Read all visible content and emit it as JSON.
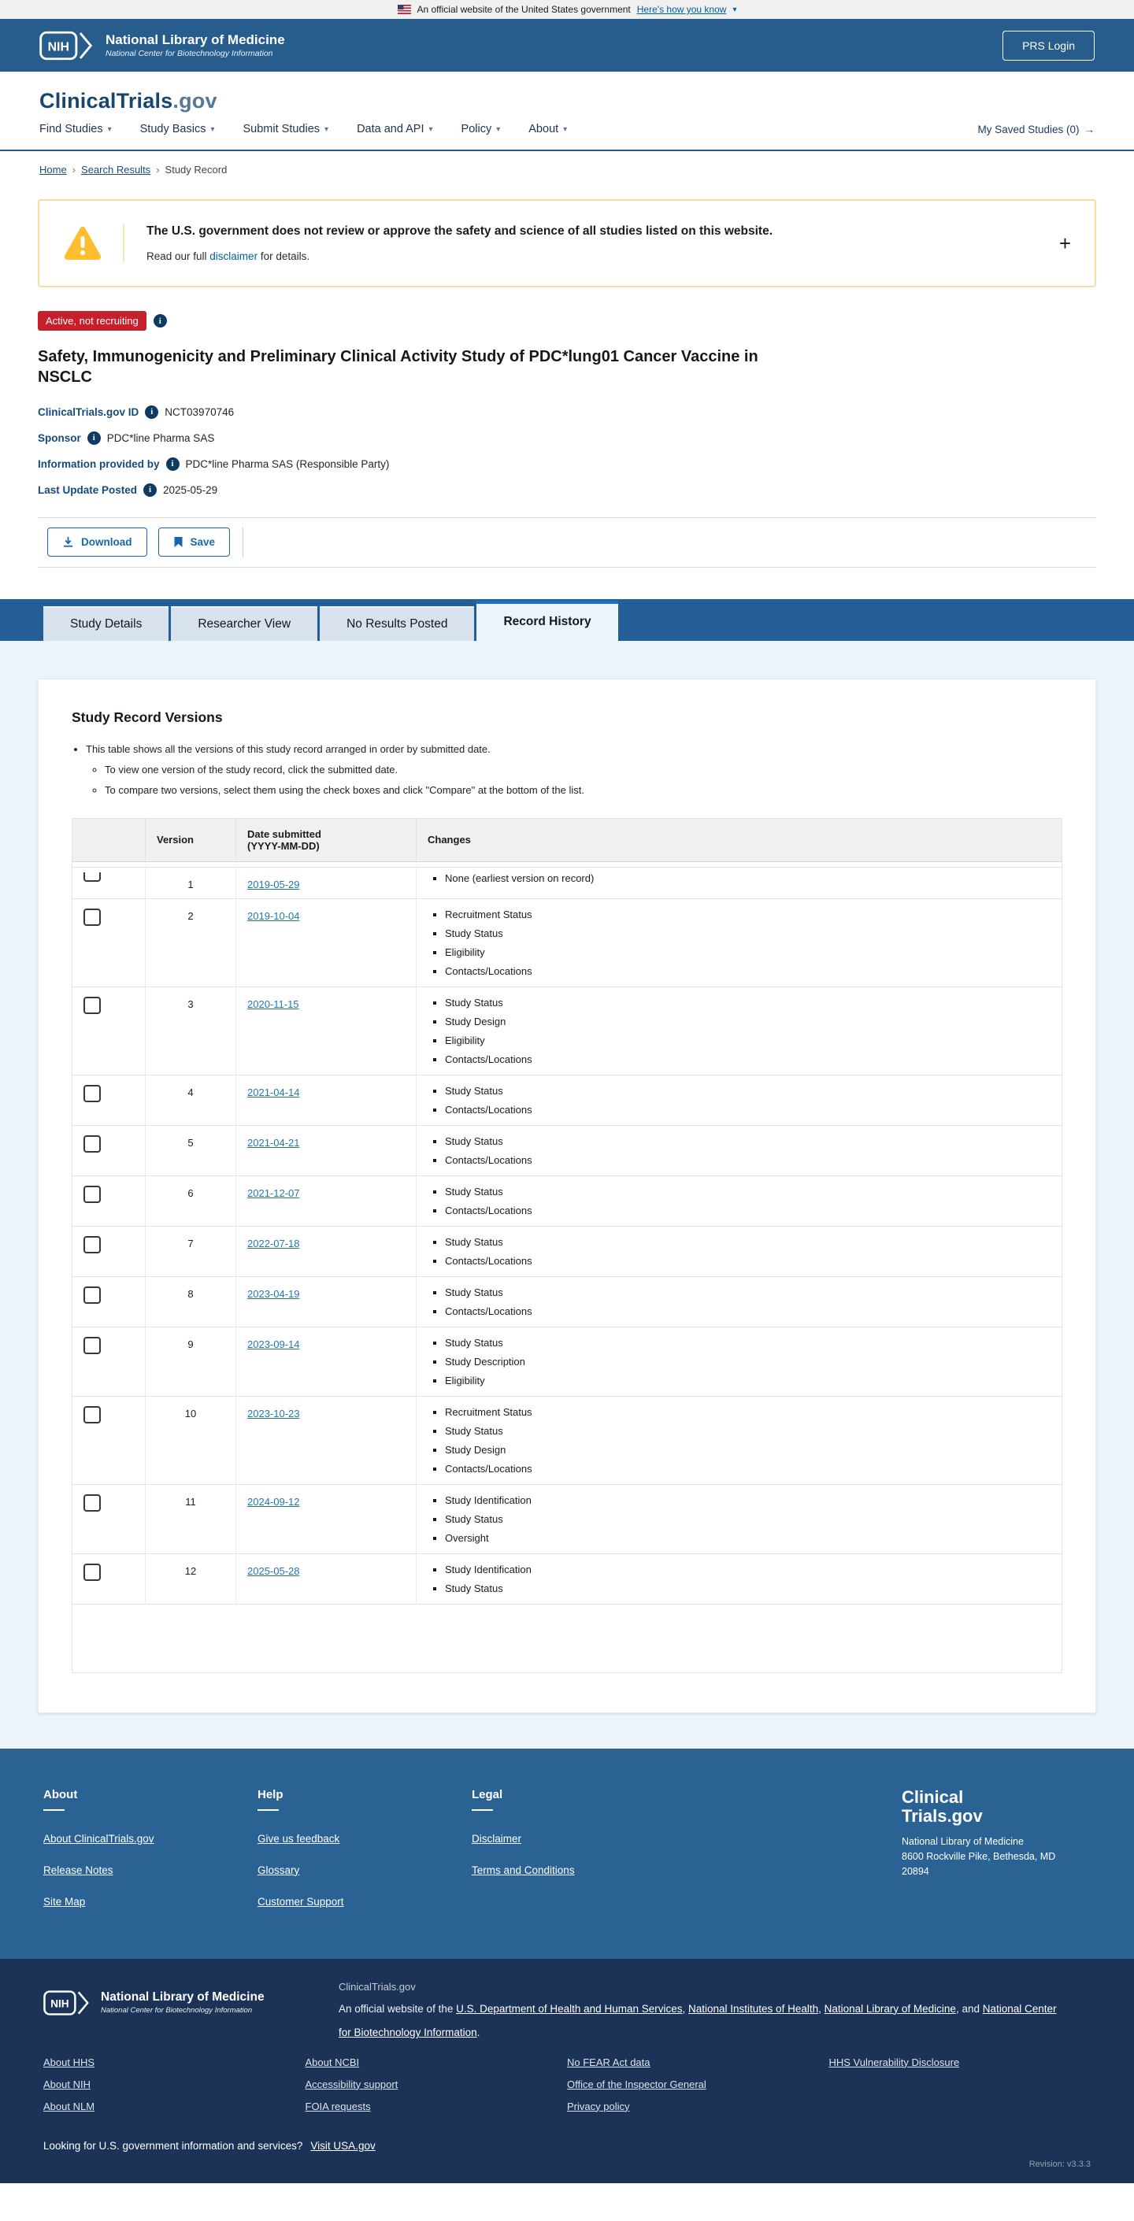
{
  "colors": {
    "header_blue": "#275d8c",
    "tab_bar_blue": "#235f96",
    "active_tab_accent": "#1473cf",
    "status_red": "#c5202c",
    "date_link_blue": "#2077b4",
    "footer_blue": "#2b6294",
    "footer_navy": "#1b3356",
    "section_bg": "#ecf3fa",
    "warning_yellow": "#ffbe2e"
  },
  "gov_banner": {
    "text": "An official website of the United States government",
    "link": "Here's how you know"
  },
  "nlm_header": {
    "logo": "NIH",
    "org": "National Library of Medicine",
    "suborg": "National Center for Biotechnology Information",
    "login_button": "PRS Login"
  },
  "brand": {
    "name": "ClinicalTrials",
    "suffix": ".gov"
  },
  "nav": {
    "items": [
      "Find Studies",
      "Study Basics",
      "Submit Studies",
      "Data and API",
      "Policy",
      "About"
    ],
    "saved_studies": "My Saved Studies (0)",
    "saved_arrow": "→"
  },
  "breadcrumb": [
    "Home",
    "Search Results",
    "Study Record"
  ],
  "warning": {
    "heading": "The U.S. government does not review or approve the safety and science of all studies listed on this website.",
    "body_prefix": "Read our full ",
    "body_link": "disclaimer",
    "body_suffix": " for details.",
    "expand_icon": "+"
  },
  "study": {
    "status_badge": "Active, not recruiting",
    "title": "Safety, Immunogenicity and Preliminary Clinical Activity Study of PDC*lung01 Cancer Vaccine in NSCLC",
    "meta": [
      {
        "label": "ClinicalTrials.gov ID",
        "value": "NCT03970746"
      },
      {
        "label": "Sponsor",
        "value": "PDC*line Pharma SAS"
      },
      {
        "label": "Information provided by",
        "value": "PDC*line Pharma SAS (Responsible Party)"
      },
      {
        "label": "Last Update Posted",
        "value": "2025-05-29"
      }
    ]
  },
  "actions": {
    "download": "Download",
    "save": "Save"
  },
  "tabs": [
    {
      "label": "Study Details",
      "active": false
    },
    {
      "label": "Researcher View",
      "active": false
    },
    {
      "label": "No Results Posted",
      "active": false
    },
    {
      "label": "Record History",
      "active": true
    }
  ],
  "versions": {
    "heading": "Study Record Versions",
    "notes": [
      "This table shows all the versions of this study record arranged in order by submitted date.",
      "To view one version of the study record, click the submitted date.",
      "To compare two versions, select them using the check boxes and click \"Compare\" at the bottom of the list."
    ],
    "headers": {
      "version": "Version",
      "date_line1": "Date submitted",
      "date_line2": "(YYYY-MM-DD)",
      "changes": "Changes"
    },
    "rows": [
      {
        "version": "1",
        "date": "2019-05-29",
        "changes": [
          "None (earliest version on record)"
        ]
      },
      {
        "version": "2",
        "date": "2019-10-04",
        "changes": [
          "Recruitment Status",
          "Study Status",
          "Eligibility",
          "Contacts/Locations"
        ]
      },
      {
        "version": "3",
        "date": "2020-11-15",
        "changes": [
          "Study Status",
          "Study Design",
          "Eligibility",
          "Contacts/Locations"
        ]
      },
      {
        "version": "4",
        "date": "2021-04-14",
        "changes": [
          "Study Status",
          "Contacts/Locations"
        ]
      },
      {
        "version": "5",
        "date": "2021-04-21",
        "changes": [
          "Study Status",
          "Contacts/Locations"
        ]
      },
      {
        "version": "6",
        "date": "2021-12-07",
        "changes": [
          "Study Status",
          "Contacts/Locations"
        ]
      },
      {
        "version": "7",
        "date": "2022-07-18",
        "changes": [
          "Study Status",
          "Contacts/Locations"
        ]
      },
      {
        "version": "8",
        "date": "2023-04-19",
        "changes": [
          "Study Status",
          "Contacts/Locations"
        ]
      },
      {
        "version": "9",
        "date": "2023-09-14",
        "changes": [
          "Study Status",
          "Study Description",
          "Eligibility"
        ]
      },
      {
        "version": "10",
        "date": "2023-10-23",
        "changes": [
          "Recruitment Status",
          "Study Status",
          "Study Design",
          "Contacts/Locations"
        ]
      },
      {
        "version": "11",
        "date": "2024-09-12",
        "changes": [
          "Study Identification",
          "Study Status",
          "Oversight"
        ]
      },
      {
        "version": "12",
        "date": "2025-05-28",
        "changes": [
          "Study Identification",
          "Study Status"
        ]
      }
    ]
  },
  "footer": {
    "columns": [
      {
        "heading": "About",
        "links": [
          "About ClinicalTrials.gov",
          "Release Notes",
          "Site Map"
        ]
      },
      {
        "heading": "Help",
        "links": [
          "Give us feedback",
          "Glossary",
          "Customer Support"
        ]
      },
      {
        "heading": "Legal",
        "links": [
          "Disclaimer",
          "Terms and Conditions"
        ]
      }
    ],
    "wordmark_line1": "Clinical",
    "wordmark_line2": "Trials.gov",
    "address_lines": [
      "National Library of Medicine",
      "8600 Rockville Pike, Bethesda, MD",
      "20894"
    ]
  },
  "subfooter": {
    "logo": "NIH",
    "org": "National Library of Medicine",
    "suborg": "National Center for Biotechnology Information",
    "site": "ClinicalTrials.gov",
    "agency_parts": [
      {
        "text": "An official website of the "
      },
      {
        "link": "U.S. Department of Health and Human Services"
      },
      {
        "text": ", "
      },
      {
        "link": "National Institutes of Health"
      },
      {
        "text": ", "
      },
      {
        "link": "National Library of Medicine"
      },
      {
        "text": ", and "
      },
      {
        "link": "National Center for Biotechnology Information"
      },
      {
        "text": "."
      }
    ],
    "link_columns": [
      [
        "About HHS",
        "About NIH",
        "About NLM"
      ],
      [
        "About NCBI",
        "Accessibility support",
        "FOIA requests"
      ],
      [
        "No FEAR Act data",
        "Office of the Inspector General",
        "Privacy policy"
      ],
      [
        "HHS Vulnerability Disclosure"
      ]
    ],
    "usa_prompt": "Looking for U.S. government information and services?",
    "usa_link": "Visit USA.gov",
    "revision": "Revision: v3.3.3"
  }
}
